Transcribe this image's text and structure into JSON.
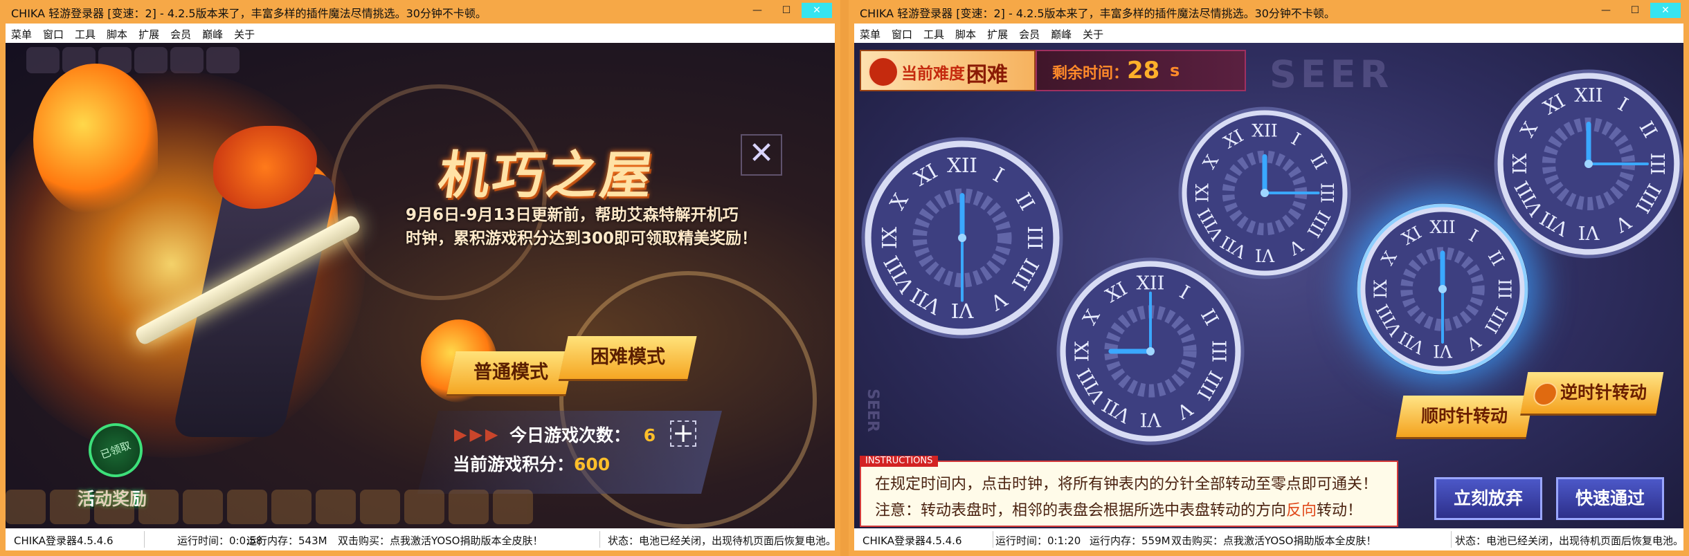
{
  "left_window": {
    "title": "CHIKA 轻游登录器 [变速：2] - 4.2.5版本来了，丰富多样的插件魔法尽情挑选。30分钟不卡顿。",
    "menu": [
      "菜单",
      "窗口",
      "工具",
      "脚本",
      "扩展",
      "会员",
      "巅峰",
      "关于"
    ],
    "game": {
      "title": "机巧之屋",
      "description_line1": "9月6日-9月13日更新前，帮助艾森特解开机巧",
      "description_line2": "时钟，累积游戏积分达到300即可领取精美奖励！",
      "close_glyph": "✕",
      "normal_mode": "普通模式",
      "hard_mode": "困难模式",
      "plays_today_label": "今日游戏次数：",
      "plays_today_value": "6",
      "plus_glyph": "+",
      "score_label": "当前游戏积分：",
      "score_value": "600",
      "event_reward": "活动奖励",
      "event_badge": "已领取"
    },
    "status": {
      "version": "CHIKA登录器4.5.4.6",
      "runtime": "运行时间：0:0:58",
      "memory": "运行内存：543M",
      "promo": "双击购买：点我激活YOSO捐助版本全皮肤！",
      "state": "状态：电池已经关闭，出现待机页面后恢复电池。"
    }
  },
  "right_window": {
    "title": "CHIKA 轻游登录器 [变速：2] - 4.2.5版本来了，丰富多样的插件魔法尽情挑选。30分钟不卡顿。",
    "menu": [
      "菜单",
      "窗口",
      "工具",
      "脚本",
      "扩展",
      "会员",
      "巅峰",
      "关于"
    ],
    "game": {
      "difficulty_label": "当前难度：",
      "difficulty_value": "困难",
      "time_label": "剩余时间：",
      "time_value": "28",
      "time_unit": "s",
      "watermark": "SEER",
      "watermark_vertical": "SEER",
      "clockwise": "顺时针转动",
      "counterclockwise": "逆时针转动",
      "instructions_tag": "INSTRUCTIONS",
      "instruction_line1": "在规定时间内，点击时钟，将所有钟表内的分针全部转动至零点即可通关！",
      "instruction_line2_a": "注意：转动表盘时，相邻的表盘会根据所选中表盘转动的方向",
      "instruction_line2_hl": "反向",
      "instruction_line2_b": "转动！",
      "give_up": "立刻放弃",
      "quick_pass": "快速通过",
      "clocks": [
        {
          "id": "c1",
          "hour": 12,
          "minute": 30,
          "selected": false
        },
        {
          "id": "c2",
          "hour": 9,
          "minute": 0,
          "selected": false
        },
        {
          "id": "c3",
          "hour": 12,
          "minute": 15,
          "selected": false
        },
        {
          "id": "c4",
          "hour": 12,
          "minute": 30,
          "selected": true
        },
        {
          "id": "c5",
          "hour": 12,
          "minute": 15,
          "selected": false
        }
      ]
    },
    "status": {
      "version": "CHIKA登录器4.5.4.6",
      "runtime": "运行时间：0:1:20",
      "memory": "运行内存：559M",
      "promo": "双击购买：点我激活YOSO捐助版本全皮肤！",
      "state": "状态：电池已经关闭，出现待机页面后恢复电池。"
    }
  },
  "window_controls": {
    "minimize": "—",
    "maximize": "☐",
    "close": "✕"
  },
  "colors": {
    "frame": "#f6a847",
    "accent_blue": "#3aa0ff",
    "gold": "#ffbf2a"
  }
}
